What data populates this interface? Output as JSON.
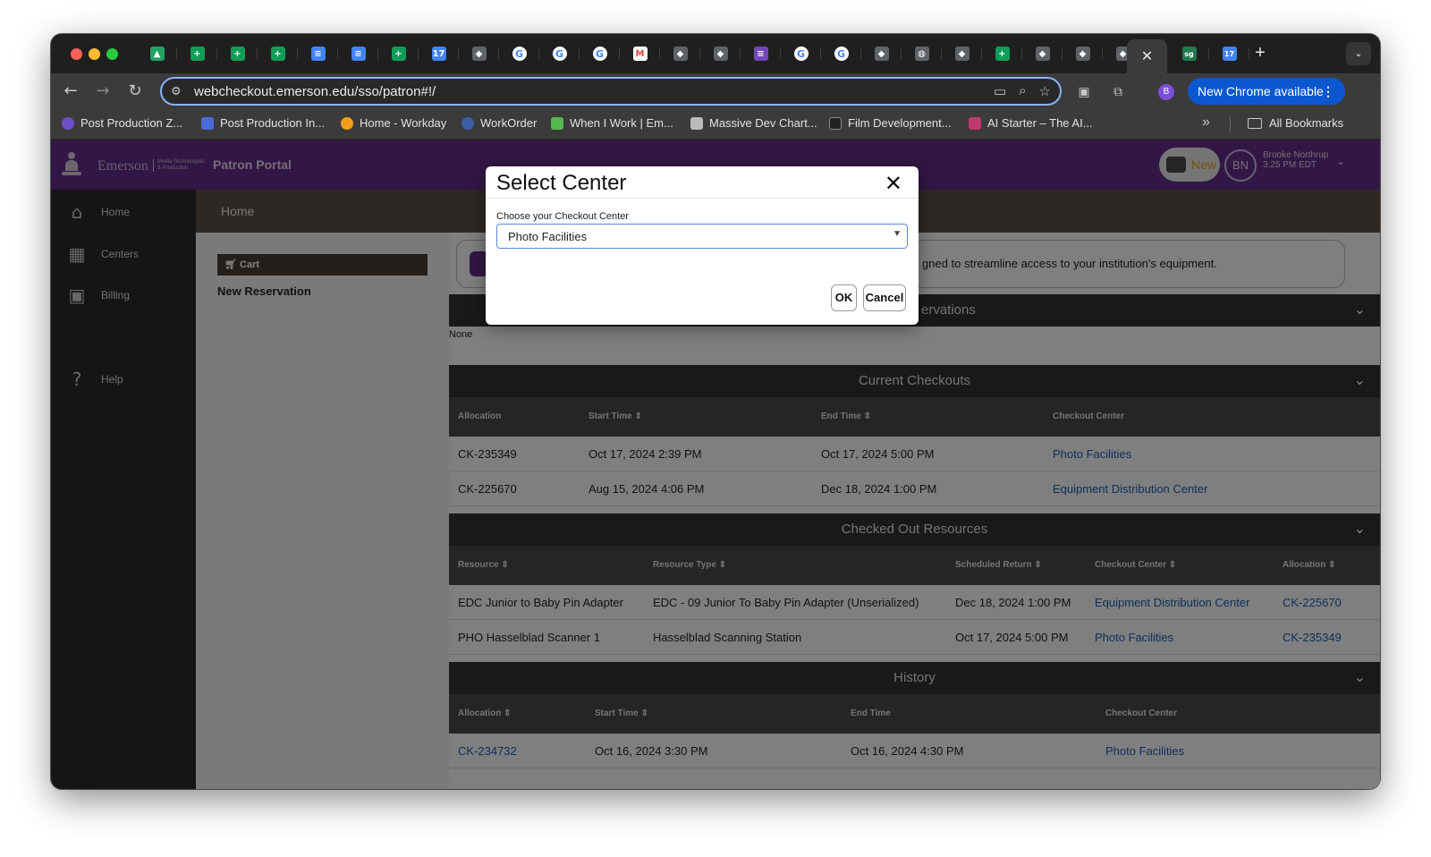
{
  "browser": {
    "tabs_icons": [
      "drive-icon",
      "sheets-icon",
      "sheets-icon",
      "sheets-icon",
      "docs-icon",
      "docs-icon",
      "sheets-icon",
      "calendar-icon",
      "site-icon",
      "google-icon",
      "google-icon",
      "google-icon",
      "gmail-icon",
      "site-icon",
      "site-icon",
      "forms-icon",
      "google-icon",
      "google-icon",
      "site-icon",
      "globe-icon",
      "site-icon",
      "sheets-icon",
      "site-icon",
      "site-icon",
      "site-icon"
    ],
    "active_tab_close": "✕",
    "after_tabs_labels": [
      "sg",
      "17"
    ],
    "new_tab": "+",
    "tab_search": "⌄",
    "url": "webcheckout.emerson.edu/sso/patron#!/",
    "profile_initial": "B",
    "update_label": "New Chrome available",
    "update_dots": "⋮",
    "bookmarks": [
      {
        "label": "Post Production Z...",
        "color": "#6e4fc9"
      },
      {
        "label": "Post Production In...",
        "color": "#4b6bd6"
      },
      {
        "label": "Home - Workday",
        "color": "#f29f1b"
      },
      {
        "label": "WorkOrder",
        "color": "#3a5fa8"
      },
      {
        "label": "When I Work | Em...",
        "color": "#55b84b"
      },
      {
        "label": "Massive Dev Chart...",
        "color": "#bbbbbb"
      },
      {
        "label": "Film Development...",
        "color": "#222222"
      },
      {
        "label": "AI Starter – The AI...",
        "color": "#c0396b"
      }
    ],
    "bookmarks_more": "»",
    "all_bookmarks": "All Bookmarks"
  },
  "header": {
    "brand": "Emerson",
    "brand_sub_line1": "Media Technologies",
    "brand_sub_line2": "& Production",
    "portal_title": "Patron Portal",
    "new_label": "New",
    "user_initials": "BN",
    "user_name": "Brooke Northrup",
    "user_time": "3:25 PM EDT"
  },
  "sidebar": {
    "items": [
      {
        "label": "Home",
        "icon": "home-icon"
      },
      {
        "label": "Centers",
        "icon": "building-icon"
      },
      {
        "label": "Billing",
        "icon": "money-icon"
      },
      {
        "label": "Help",
        "icon": "question-icon"
      }
    ]
  },
  "breadcrumb": "Home",
  "left_panel": {
    "cart_label": "Cart",
    "new_reservation": "New Reservation"
  },
  "main": {
    "banner_text": "gned to streamline access to your institution's equipment.",
    "reservations_title": "ervations",
    "reservations_none": "None",
    "current_checkouts": {
      "title": "Current Checkouts",
      "columns": [
        "Allocation",
        "Start Time ⇕",
        "End Time ⇕",
        "Checkout Center"
      ],
      "rows": [
        [
          "CK-235349",
          "Oct 17, 2024 2:39 PM",
          "Oct 17, 2024 5:00 PM",
          "Photo Facilities"
        ],
        [
          "CK-225670",
          "Aug 15, 2024 4:06 PM",
          "Dec 18, 2024 1:00 PM",
          "Equipment Distribution Center"
        ]
      ]
    },
    "checked_out_resources": {
      "title": "Checked Out Resources",
      "columns": [
        "Resource ⇕",
        "Resource Type ⇕",
        "Scheduled Return ⇕",
        "Checkout Center ⇕",
        "Allocation ⇕"
      ],
      "rows": [
        [
          "EDC Junior to Baby Pin Adapter",
          "EDC - 09 Junior To Baby Pin Adapter (Unserialized)",
          "Dec 18, 2024 1:00 PM",
          "Equipment Distribution Center",
          "CK-225670"
        ],
        [
          "PHO Hasselblad Scanner 1",
          "Hasselblad Scanning Station",
          "Oct 17, 2024 5:00 PM",
          "Photo Facilities",
          "CK-235349"
        ]
      ]
    },
    "history": {
      "title": "History",
      "columns": [
        "Allocation ⇕",
        "Start Time ⇕",
        "End Time",
        "Checkout Center"
      ],
      "rows": [
        [
          "CK-234732",
          "Oct 16, 2024 3:30 PM",
          "Oct 16, 2024 4:30 PM",
          "Photo Facilities"
        ]
      ]
    },
    "chevron": "⌄"
  },
  "modal": {
    "title": "Select Center",
    "close": "✕",
    "label": "Choose your Checkout Center",
    "selected": "Photo Facilities",
    "ok": "OK",
    "cancel": "Cancel"
  }
}
